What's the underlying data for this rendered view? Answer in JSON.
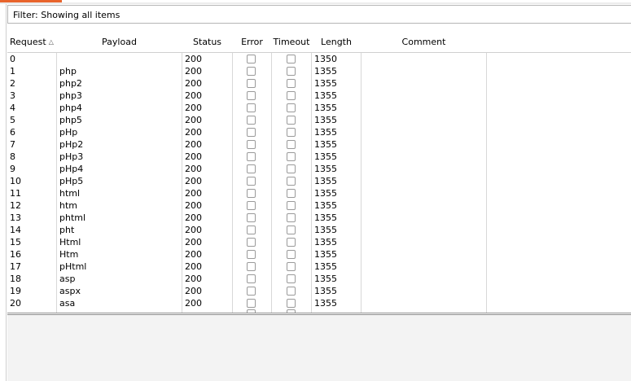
{
  "filter": {
    "label": "Filter: Showing all items"
  },
  "table": {
    "columns": [
      "Request",
      "Payload",
      "Status",
      "Error",
      "Timeout",
      "Length",
      "Comment"
    ],
    "sort_column": "Request",
    "sort_direction": "ascending",
    "rows": [
      {
        "request": "0",
        "payload": "",
        "status": "200",
        "length": "1350"
      },
      {
        "request": "1",
        "payload": "php",
        "status": "200",
        "length": "1355"
      },
      {
        "request": "2",
        "payload": "php2",
        "status": "200",
        "length": "1355"
      },
      {
        "request": "3",
        "payload": "php3",
        "status": "200",
        "length": "1355"
      },
      {
        "request": "4",
        "payload": "php4",
        "status": "200",
        "length": "1355"
      },
      {
        "request": "5",
        "payload": "php5",
        "status": "200",
        "length": "1355"
      },
      {
        "request": "6",
        "payload": "pHp",
        "status": "200",
        "length": "1355"
      },
      {
        "request": "7",
        "payload": "pHp2",
        "status": "200",
        "length": "1355"
      },
      {
        "request": "8",
        "payload": "pHp3",
        "status": "200",
        "length": "1355"
      },
      {
        "request": "9",
        "payload": "pHp4",
        "status": "200",
        "length": "1355"
      },
      {
        "request": "10",
        "payload": "pHp5",
        "status": "200",
        "length": "1355"
      },
      {
        "request": "11",
        "payload": "html",
        "status": "200",
        "length": "1355"
      },
      {
        "request": "12",
        "payload": "htm",
        "status": "200",
        "length": "1355"
      },
      {
        "request": "13",
        "payload": "phtml",
        "status": "200",
        "length": "1355"
      },
      {
        "request": "14",
        "payload": "pht",
        "status": "200",
        "length": "1355"
      },
      {
        "request": "15",
        "payload": "Html",
        "status": "200",
        "length": "1355"
      },
      {
        "request": "16",
        "payload": "Htm",
        "status": "200",
        "length": "1355"
      },
      {
        "request": "17",
        "payload": "pHtml",
        "status": "200",
        "length": "1355"
      },
      {
        "request": "18",
        "payload": "asp",
        "status": "200",
        "length": "1355"
      },
      {
        "request": "19",
        "payload": "aspx",
        "status": "200",
        "length": "1355"
      },
      {
        "request": "20",
        "payload": "asa",
        "status": "200",
        "length": "1355"
      }
    ]
  },
  "colors": {
    "accent": "#e8642c",
    "grid": "#e6e6e6",
    "border": "#b5b5b5"
  }
}
